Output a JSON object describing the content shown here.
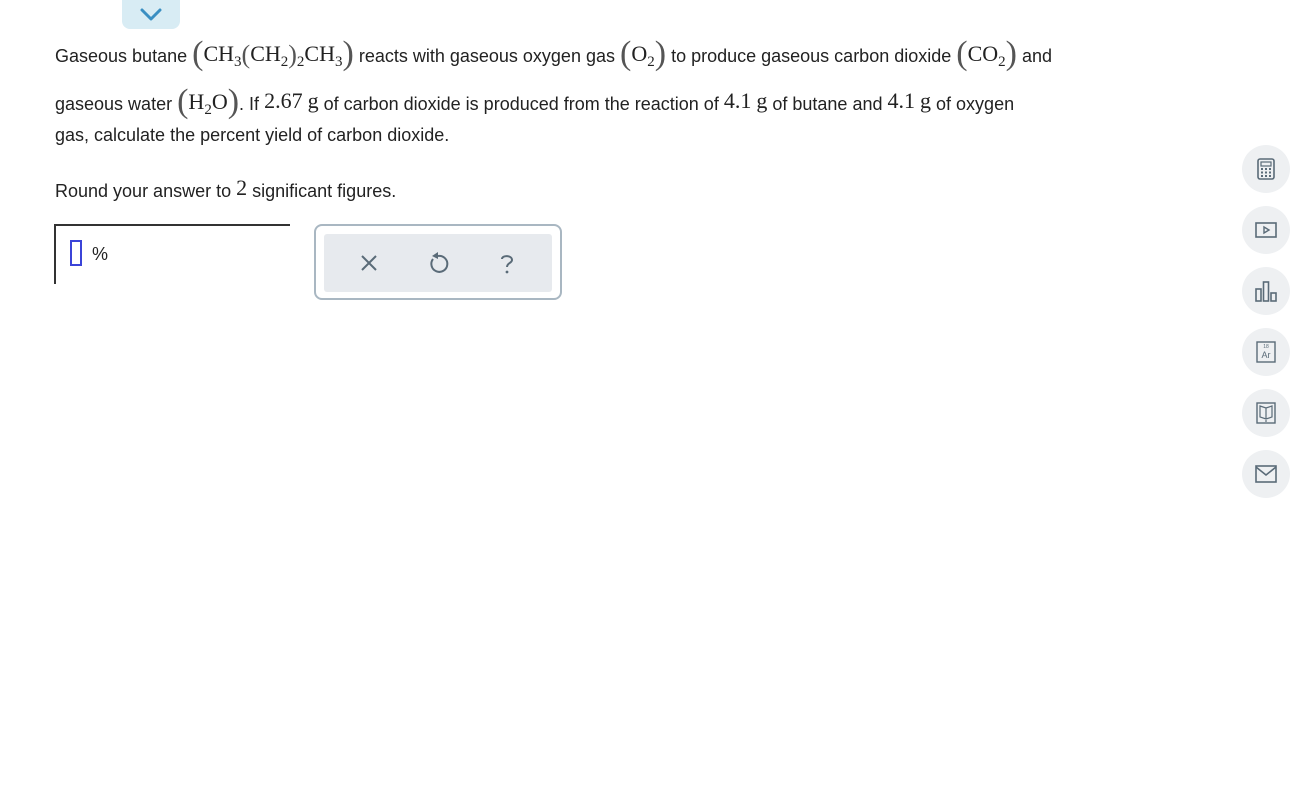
{
  "collapse": {
    "icon": "chevron-down-icon"
  },
  "question": {
    "t_gaseous_butane": "Gaseous butane",
    "butane": {
      "ch3_a": "CH",
      "sub3a": "3",
      "ch2": "CH",
      "sub2": "2",
      "sub2b": "2",
      "ch3_b": "CH",
      "sub3b": "3"
    },
    "t_reacts": "reacts with gaseous oxygen gas",
    "oxygen": {
      "o": "O",
      "sub": "2"
    },
    "t_produce": "to produce gaseous carbon dioxide",
    "co2": {
      "co": "CO",
      "sub": "2"
    },
    "t_and": "and",
    "t_gaseous_water": "gaseous water",
    "water": {
      "h": "H",
      "sub": "2",
      "o": "O"
    },
    "t_if": ". If",
    "mass_co2": "2.67",
    "unit_g1": "g",
    "t_of_co2": "of carbon dioxide is produced from the reaction of",
    "mass_butane": "4.1",
    "unit_g2": "g",
    "t_of_butane": "of butane and",
    "mass_o2": "4.1",
    "unit_g3": "g",
    "t_of_oxygen": "of oxygen",
    "t_line3": "gas, calculate the percent yield of carbon dioxide.",
    "t_round": "Round your answer to",
    "sigfigs": "2",
    "t_sigfigs": "significant figures."
  },
  "answer": {
    "value": "",
    "unit": "%"
  },
  "tools": [
    {
      "name": "clear-button",
      "icon": "close-icon"
    },
    {
      "name": "undo-button",
      "icon": "undo-icon"
    },
    {
      "name": "help-button",
      "icon": "help-icon"
    }
  ],
  "sidebar": [
    {
      "name": "calculator-button",
      "icon": "calculator-icon"
    },
    {
      "name": "video-button",
      "icon": "video-icon"
    },
    {
      "name": "data-button",
      "icon": "bar-chart-icon"
    },
    {
      "name": "periodic-table-button",
      "icon": "periodic-table-icon",
      "label_num": "18",
      "label_sym": "Ar"
    },
    {
      "name": "textbook-button",
      "icon": "book-icon"
    },
    {
      "name": "message-button",
      "icon": "mail-icon"
    }
  ],
  "colors": {
    "accent_tab": "#d8ecf4",
    "cursor": "#3b44d8",
    "tool_bg": "#e7eaee",
    "icon": "#5a6b78"
  }
}
